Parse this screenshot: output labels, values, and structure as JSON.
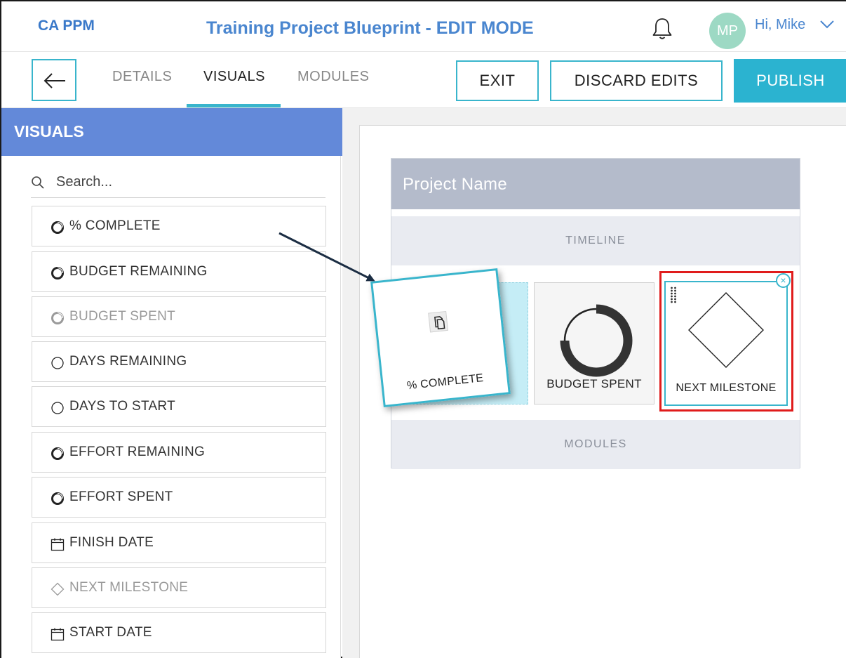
{
  "header": {
    "brand": "CA PPM",
    "title": "Training Project Blueprint - EDIT MODE",
    "avatar_initials": "MP",
    "greeting": "Hi, Mike"
  },
  "tabs": [
    {
      "label": "DETAILS",
      "active": false
    },
    {
      "label": "VISUALS",
      "active": true
    },
    {
      "label": "MODULES",
      "active": false
    }
  ],
  "actions": {
    "exit": "EXIT",
    "discard": "DISCARD EDITS",
    "publish": "PUBLISH"
  },
  "sidebar": {
    "title": "VISUALS",
    "search_placeholder": "Search...",
    "items": [
      {
        "label": "% COMPLETE",
        "icon": "ring-icon",
        "disabled": false
      },
      {
        "label": "BUDGET REMAINING",
        "icon": "ring-icon",
        "disabled": false
      },
      {
        "label": "BUDGET SPENT",
        "icon": "ring-icon",
        "disabled": true
      },
      {
        "label": "DAYS REMAINING",
        "icon": "circle-icon",
        "disabled": false
      },
      {
        "label": "DAYS TO START",
        "icon": "circle-icon",
        "disabled": false
      },
      {
        "label": "EFFORT REMAINING",
        "icon": "ring-icon",
        "disabled": false
      },
      {
        "label": "EFFORT SPENT",
        "icon": "ring-icon",
        "disabled": false
      },
      {
        "label": "FINISH DATE",
        "icon": "calendar-icon",
        "disabled": false
      },
      {
        "label": "NEXT MILESTONE",
        "icon": "diamond-icon",
        "disabled": true
      },
      {
        "label": "START DATE",
        "icon": "calendar-icon",
        "disabled": false
      }
    ]
  },
  "canvas": {
    "project_name": "Project Name",
    "timeline_label": "TIMELINE",
    "modules_label": "MODULES",
    "tiles": {
      "dragging": "% COMPLETE",
      "budget_spent": "BUDGET SPENT",
      "next_milestone": "NEXT MILESTONE"
    },
    "remove_symbol": "×"
  },
  "colors": {
    "accent": "#39b5cc",
    "brand_blue": "#4a86cf",
    "sidebar_header": "#6389d9",
    "highlight": "#e01c1c",
    "avatar": "#9dd9c4"
  }
}
